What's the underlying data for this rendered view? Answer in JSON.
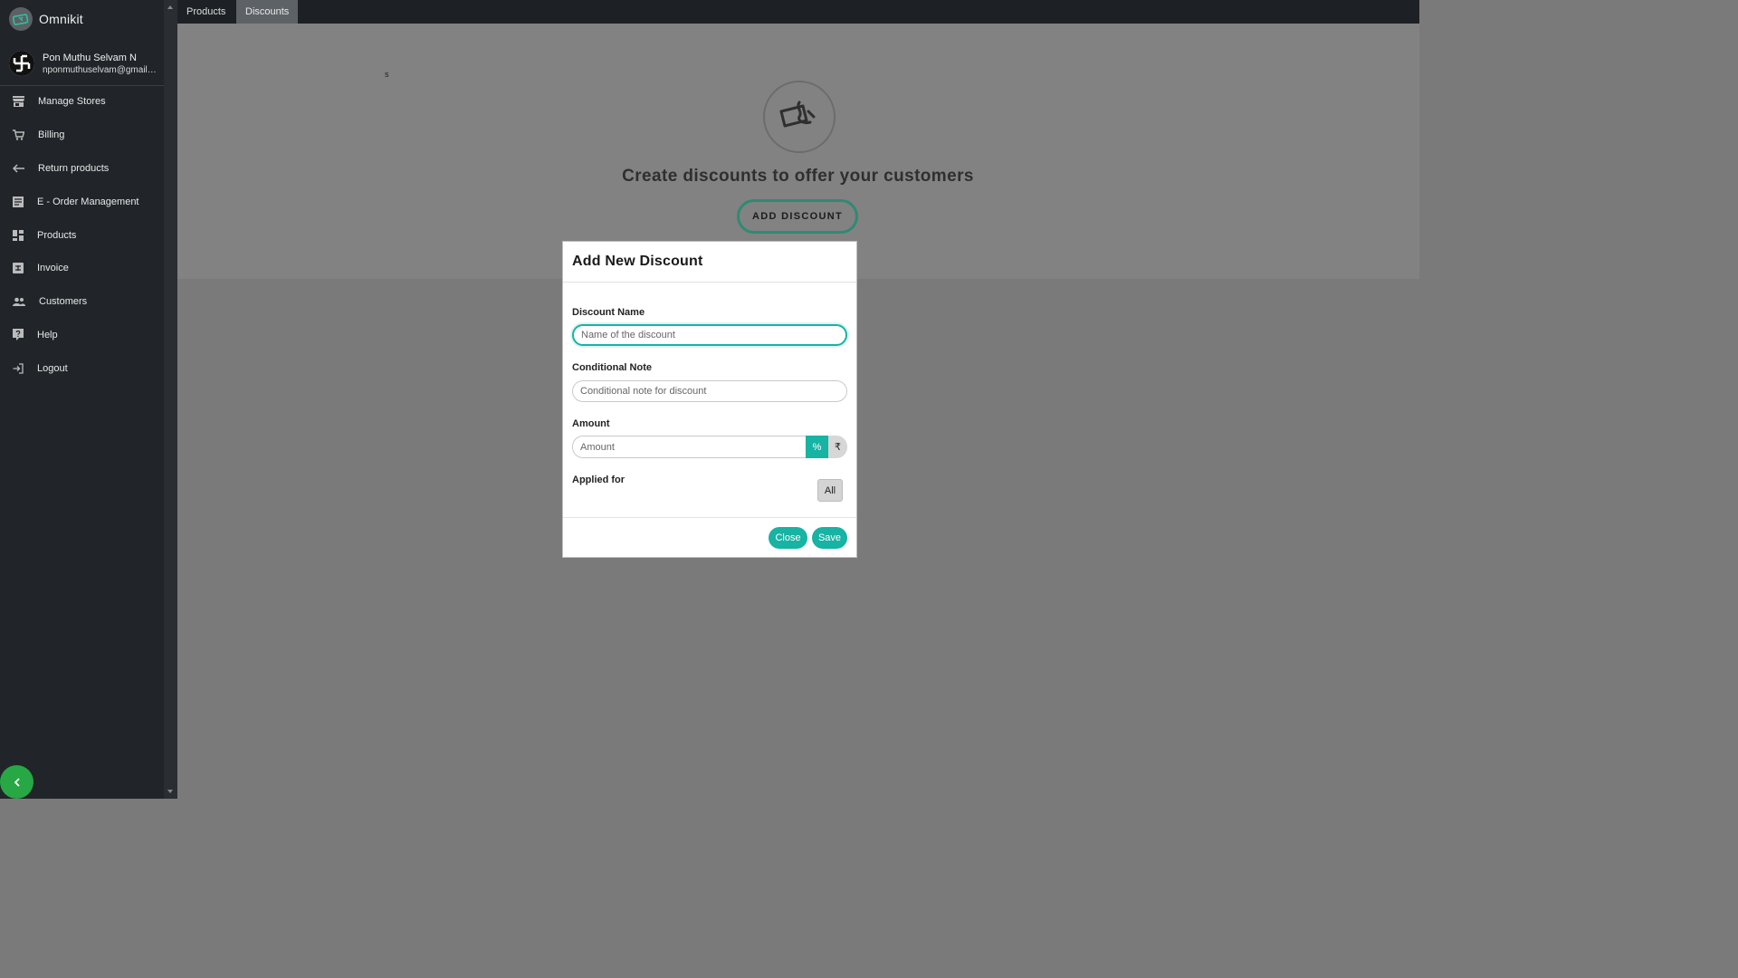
{
  "app": {
    "name": "Omnikit"
  },
  "user": {
    "name": "Pon Muthu Selvam N",
    "email": "nponmuthuselvam@gmail.c..."
  },
  "sidebar": {
    "items": [
      {
        "label": "Manage Stores",
        "icon": "store-icon"
      },
      {
        "label": "Billing",
        "icon": "cart-icon"
      },
      {
        "label": "Return products",
        "icon": "return-arrow-icon"
      },
      {
        "label": "E - Order Management",
        "icon": "list-icon"
      },
      {
        "label": "Products",
        "icon": "dashboard-grid-icon"
      },
      {
        "label": "Invoice",
        "icon": "invoice-icon"
      },
      {
        "label": "Customers",
        "icon": "people-icon"
      },
      {
        "label": "Help",
        "icon": "help-icon"
      },
      {
        "label": "Logout",
        "icon": "logout-icon"
      }
    ],
    "collapse_icon": "chevron-left-icon"
  },
  "tabs": [
    {
      "label": "Products",
      "active": false
    },
    {
      "label": "Discounts",
      "active": true
    }
  ],
  "main": {
    "stray_text": "s",
    "hero_title": "Create discounts to offer your customers",
    "add_discount_label": "ADD DISCOUNT"
  },
  "modal": {
    "title": "Add New Discount",
    "discount_name": {
      "label": "Discount Name",
      "placeholder": "Name of the discount",
      "value": ""
    },
    "conditional_note": {
      "label": "Conditional Note",
      "placeholder": "Conditional note for discount",
      "value": ""
    },
    "amount": {
      "label": "Amount",
      "placeholder": "Amount",
      "value": "",
      "percent_label": "%",
      "rupee_label": "₹"
    },
    "applied_for": {
      "label": "Applied for",
      "option_label": "All"
    },
    "close_label": "Close",
    "save_label": "Save"
  },
  "colors": {
    "accent": "#17b3a3",
    "sidebar_bg": "#212529",
    "collapse_button": "#28a745",
    "overlay": "#7a7a7a"
  }
}
